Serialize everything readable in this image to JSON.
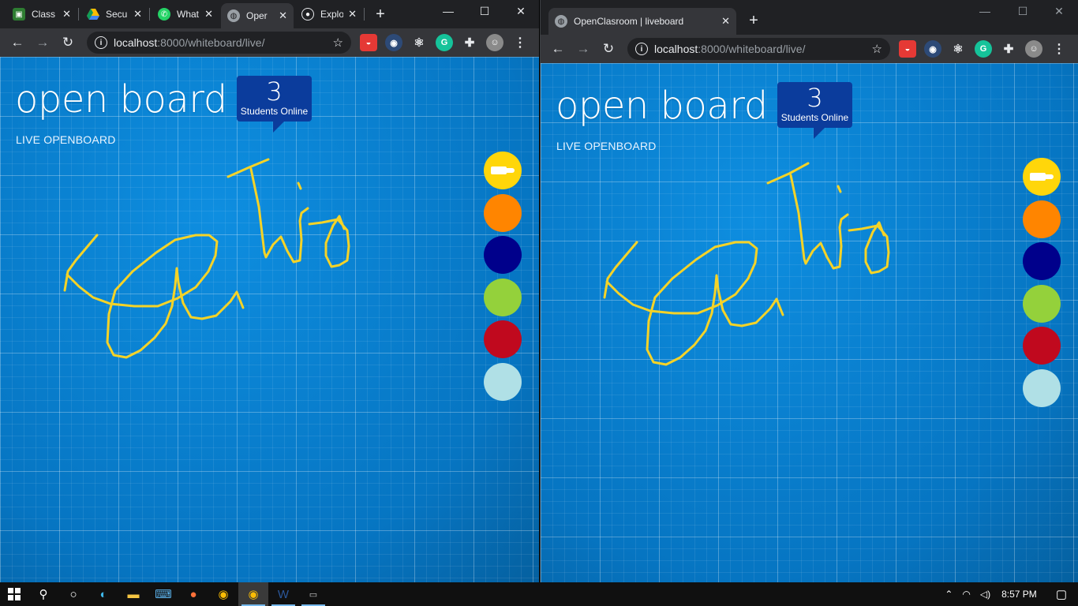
{
  "left_window": {
    "tabs": [
      {
        "title": "Class",
        "icon": "classroom-icon",
        "color": "#2e7d32"
      },
      {
        "title": "Secu",
        "icon": "drive-icon",
        "color": "#fbbc04"
      },
      {
        "title": "What",
        "icon": "whatsapp-icon",
        "color": "#25d366"
      },
      {
        "title": "Oper",
        "icon": "globe-icon",
        "color": "#9aa0a6"
      },
      {
        "title": "Explo",
        "icon": "github-icon",
        "color": "#202124"
      }
    ],
    "url_host": "localhost",
    "url_path": ":8000/whiteboard/live/"
  },
  "right_window": {
    "tabs": [
      {
        "title": "OpenClasroom | liveboard",
        "icon": "globe-icon",
        "color": "#9aa0a6"
      }
    ],
    "url_host": "localhost",
    "url_path": ":8000/whiteboard/live/"
  },
  "board": {
    "brand": "open board",
    "subtitle": "LIVE OPENBOARD",
    "online_count": "3",
    "online_label": "Students Online",
    "palette": [
      "#ffd60a",
      "#ff8500",
      "#00008b",
      "#94d13b",
      "#c0091e",
      "#b0e0e6"
    ],
    "stroke_color": "#f5d327"
  },
  "taskbar": {
    "clock": "8:57 PM"
  }
}
